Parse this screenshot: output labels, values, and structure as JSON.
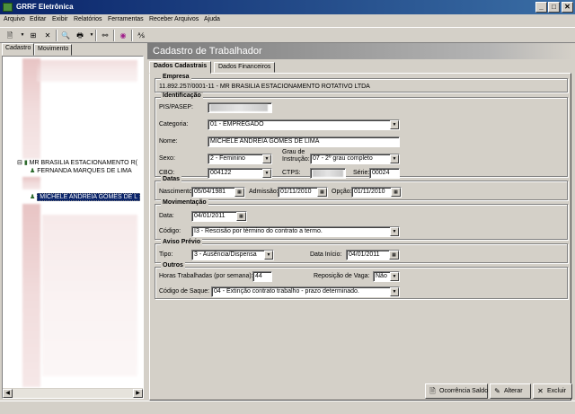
{
  "window": {
    "title": "GRRF Eletrônica",
    "min": "_",
    "max": "□",
    "close": "✕"
  },
  "menu": [
    "Arquivo",
    "Editar",
    "Exibir",
    "Relatórios",
    "Ferramentas",
    "Receber Arquivos",
    "Ajuda"
  ],
  "left": {
    "tabs": [
      "Cadastro",
      "Movimento"
    ],
    "tree": {
      "company": "MR BRASILIA ESTACIONAMENTO R(",
      "worker1": "FERNANDA MARQUES DE LIMA",
      "worker2_selected": "MICHELE ANDREIA GOMES DE L"
    }
  },
  "main": {
    "header": "Cadastro de Trabalhador",
    "tabs": [
      "Dados Cadastrais",
      "Dados Financeiros"
    ],
    "empresa": {
      "title": "Empresa",
      "value": "11.892.257/0001-11 - MR BRASILIA ESTACIONAMENTO ROTATIVO LTDA"
    },
    "identificacao": {
      "title": "Identificação",
      "pis_label": "PIS/PASEP:",
      "categoria_label": "Categoria:",
      "categoria": "01 - EMPREGADO",
      "nome_label": "Nome:",
      "nome": "MICHELE ANDREIA GOMES DE LIMA",
      "sexo_label": "Sexo:",
      "sexo": "2 - Feminino",
      "grau_label_1": "Grau de",
      "grau_label_2": "Instrução:",
      "grau": "07 - 2º grau completo",
      "cbo_label": "CBO:",
      "cbo": "004122",
      "ctps_label": "CTPS:",
      "serie_label": "Série:",
      "serie": "00024"
    },
    "datas": {
      "title": "Datas",
      "nasc_label": "Nascimento:",
      "nasc": "05/04/1981",
      "adm_label": "Admissão:",
      "adm": "01/11/2010",
      "opcao_label": "Opção:",
      "opcao": "01/11/2010"
    },
    "movimentacao": {
      "title": "Movimentação",
      "data_label": "Data:",
      "data": "04/01/2011",
      "codigo_label": "Código:",
      "codigo": "I3 - Rescisão por término do contrato a termo."
    },
    "aviso": {
      "title": "Aviso Prévio",
      "tipo_label": "Tipo:",
      "tipo": "3 - Ausência/Dispensa",
      "inicio_label": "Data Início:",
      "inicio": "04/01/2011"
    },
    "outros": {
      "title": "Outros",
      "horas_label": "Horas Trabalhadas (por semana):",
      "horas": "44",
      "reposicao_label": "Reposição de Vaga:",
      "reposicao": "Não",
      "saque_label": "Código de Saque:",
      "saque": "04 - Extinção contrato trabalho - prazo determinado."
    }
  },
  "buttons": {
    "ocorrencia": "Ocorrência Saldo",
    "alterar": "Alterar",
    "excluir": "Excluir"
  }
}
